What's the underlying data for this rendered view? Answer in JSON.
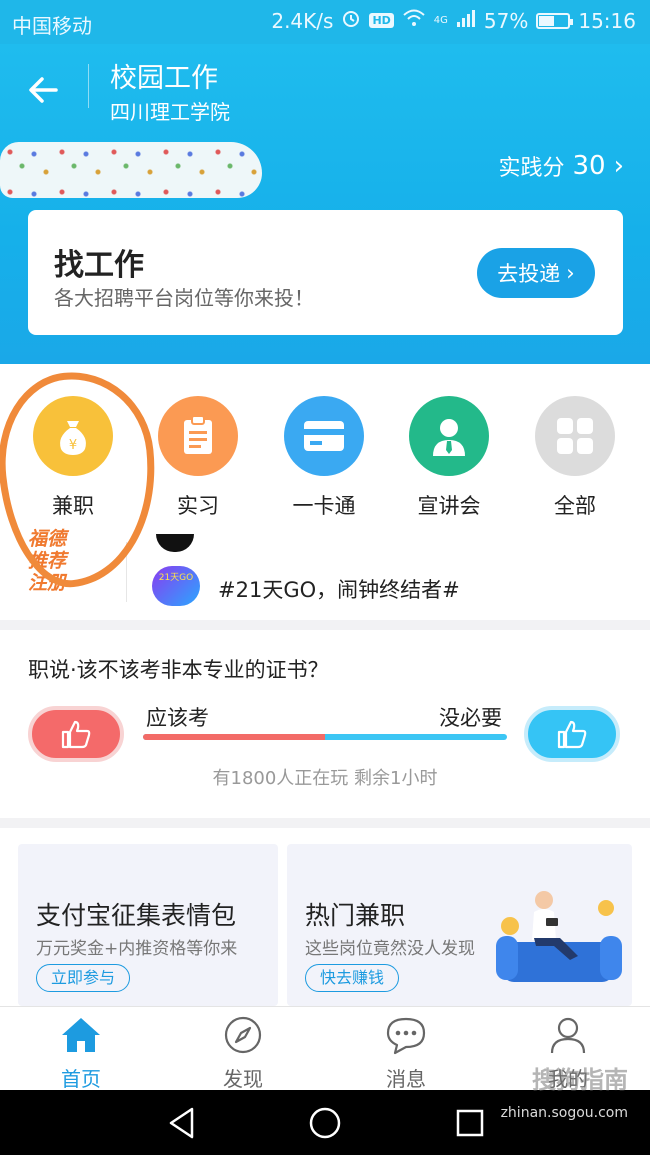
{
  "status_bar": {
    "carrier": "中国移动",
    "speed": "2.4K/s",
    "hd": "HD",
    "network": "4G",
    "battery": "57%",
    "battery_level": 0.57,
    "time": "15:16"
  },
  "header": {
    "title": "校园工作",
    "subtitle": "四川理工学院",
    "practice_label": "实践分",
    "practice_score": "30"
  },
  "job_card": {
    "title": "找工作",
    "subtitle": "各大招聘平台岗位等你来投！",
    "button": "去投递"
  },
  "quick_entries": [
    {
      "label": "兼职",
      "icon": "money-bag-icon",
      "color": "#f8c13a"
    },
    {
      "label": "实习",
      "icon": "clipboard-icon",
      "color": "#fb9a53"
    },
    {
      "label": "一卡通",
      "icon": "card-icon",
      "color": "#3aa9f2"
    },
    {
      "label": "宣讲会",
      "icon": "speaker-person-icon",
      "color": "#23b98a"
    },
    {
      "label": "全部",
      "icon": "grid-icon",
      "color": "#dcdcdc"
    }
  ],
  "news": {
    "logo_lines": [
      "福德",
      "推荐",
      "注册"
    ],
    "thumb_text": "21天GO",
    "headline": "#21天GO，闹钟终结者#"
  },
  "poll": {
    "question": "职说·该不该考非本专业的证书？",
    "option_left": "应该考",
    "option_right": "没必要",
    "left_share": 0.5,
    "footer": "有1800人正在玩 剩余1小时"
  },
  "promos": [
    {
      "title": "支付宝征集表情包",
      "subtitle": "万元奖金+内推资格等你来",
      "button": "立即参与"
    },
    {
      "title": "热门兼职",
      "subtitle": "这些岗位竟然没人发现",
      "button": "快去赚钱"
    }
  ],
  "tabs": [
    {
      "label": "首页",
      "icon": "home-icon",
      "active": true
    },
    {
      "label": "发现",
      "icon": "compass-icon",
      "active": false
    },
    {
      "label": "消息",
      "icon": "message-icon",
      "active": false
    },
    {
      "label": "我的",
      "icon": "user-icon",
      "active": false
    }
  ],
  "watermark": {
    "brand": "搜狗指南",
    "url": "zhinan.sogou.com"
  },
  "colors": {
    "primary": "#1fb7e9",
    "accent_blue": "#1d9be0",
    "vote_red": "#f46a6a",
    "vote_blue": "#35c4f5",
    "annotation": "#f08a3a"
  }
}
